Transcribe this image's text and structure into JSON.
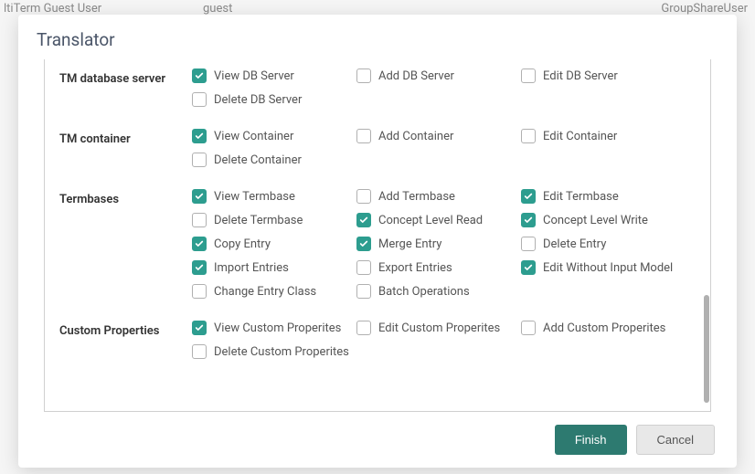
{
  "background": {
    "text1": "ltiTerm Guest User",
    "text2": "guest",
    "text3": "GroupShareUser"
  },
  "modal": {
    "title": "Translator"
  },
  "sections": {
    "tmDatabaseServer": {
      "label": "TM database server",
      "viewDbServer": "View DB Server",
      "addDbServer": "Add DB Server",
      "editDbServer": "Edit DB Server",
      "deleteDbServer": "Delete DB Server"
    },
    "tmContainer": {
      "label": "TM container",
      "viewContainer": "View Container",
      "addContainer": "Add Container",
      "editContainer": "Edit Container",
      "deleteContainer": "Delete Container"
    },
    "termbases": {
      "label": "Termbases",
      "viewTermbase": "View Termbase",
      "addTermbase": "Add Termbase",
      "editTermbase": "Edit Termbase",
      "deleteTermbase": "Delete Termbase",
      "conceptLevelRead": "Concept Level Read",
      "conceptLevelWrite": "Concept Level Write",
      "copyEntry": "Copy Entry",
      "mergeEntry": "Merge Entry",
      "deleteEntry": "Delete Entry",
      "importEntries": "Import Entries",
      "exportEntries": "Export Entries",
      "editWithoutInputModel": "Edit Without Input Model",
      "changeEntryClass": "Change Entry Class",
      "batchOperations": "Batch Operations"
    },
    "customProperties": {
      "label": "Custom Properties",
      "viewCustomProperties": "View Custom Properites",
      "editCustomProperties": "Edit Custom Properites",
      "addCustomProperties": "Add Custom Properites",
      "deleteCustomProperties": "Delete Custom Properites"
    }
  },
  "footer": {
    "finish": "Finish",
    "cancel": "Cancel"
  },
  "colors": {
    "accentTeal": "#2d9d8f",
    "primaryButton": "#2d7a70"
  }
}
